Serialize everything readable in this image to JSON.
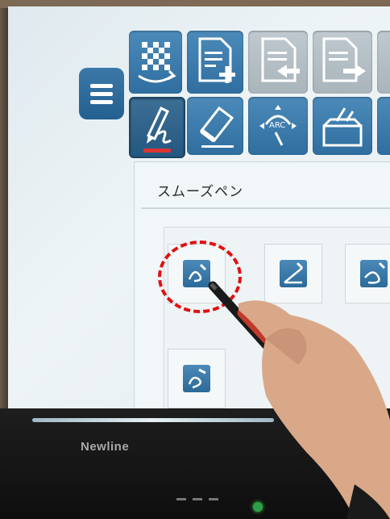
{
  "panel": {
    "title": "スムーズペン"
  },
  "device": {
    "brand": "Newline"
  },
  "toolbar": {
    "row1": [
      {
        "icon": "checkerboard-refresh-icon",
        "state": "enabled"
      },
      {
        "icon": "new-page-icon",
        "state": "enabled"
      },
      {
        "icon": "previous-page-icon",
        "state": "disabled"
      },
      {
        "icon": "next-page-icon",
        "state": "disabled"
      }
    ],
    "row2": [
      {
        "icon": "pen-tool-icon",
        "state": "active"
      },
      {
        "icon": "eraser-icon",
        "state": "enabled"
      },
      {
        "icon": "arc-gesture-icon",
        "state": "enabled"
      },
      {
        "icon": "toolbox-icon",
        "state": "enabled"
      }
    ]
  },
  "pen_options": [
    {
      "icon": "smooth-pen-icon",
      "selected": true
    },
    {
      "icon": "angle-pen-icon",
      "selected": false
    },
    {
      "icon": "curve-pen-icon",
      "selected": false
    },
    {
      "icon": "brush-pen-icon",
      "selected": false
    }
  ],
  "colors": {
    "accent": "#2f6e9f",
    "highlight": "#e01010",
    "screen_bg": "#e6eef1"
  }
}
